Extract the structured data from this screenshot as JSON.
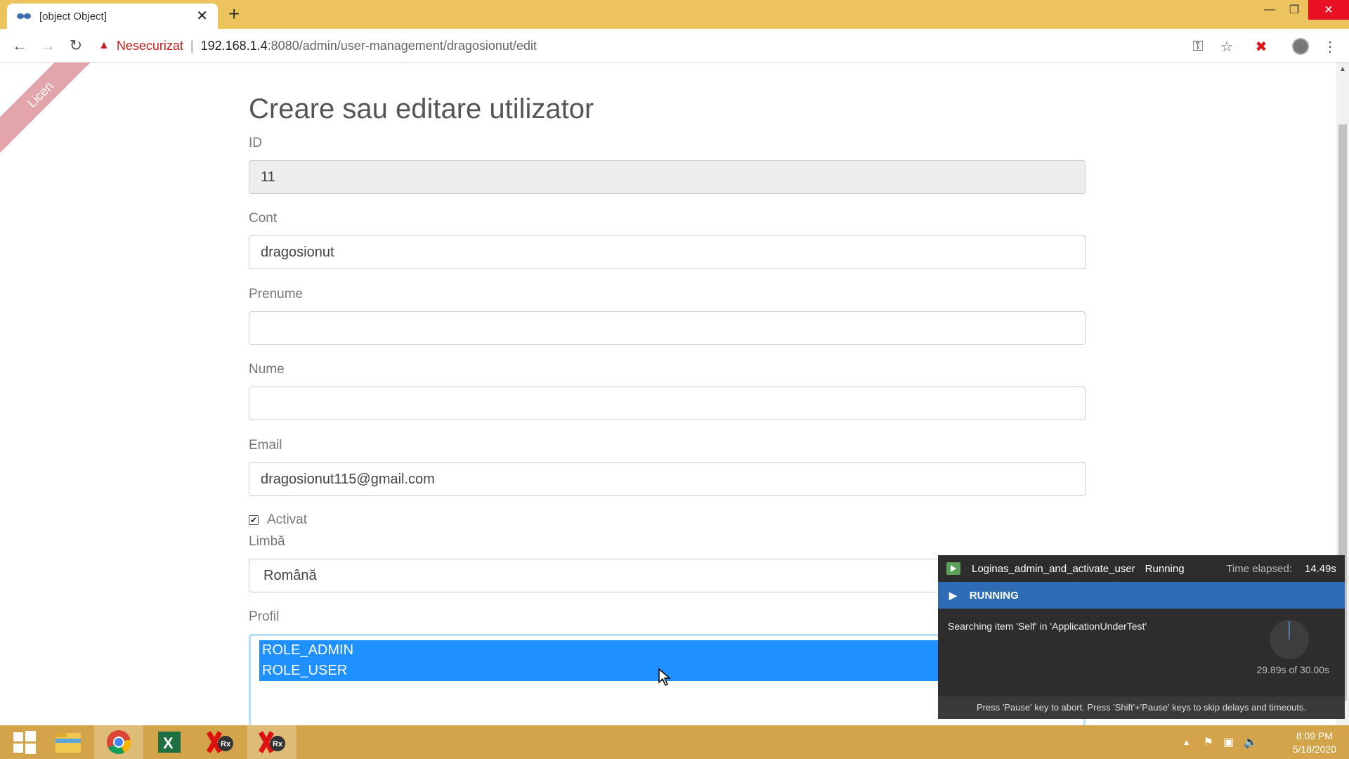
{
  "browser": {
    "tab_title": "[object Object]",
    "insecure_label": "Nesecurizat",
    "url_host": "192.168.1.4",
    "url_rest": ":8080/admin/user-management/dragosionut/edit"
  },
  "page": {
    "ribbon": "Licen",
    "title": "Creare sau editare utilizator",
    "id_label": "ID",
    "id_value": "11",
    "cont_label": "Cont",
    "cont_value": "dragosionut",
    "prenume_label": "Prenume",
    "prenume_value": "",
    "nume_label": "Nume",
    "nume_value": "",
    "email_label": "Email",
    "email_value": "dragosionut115@gmail.com",
    "activat_label": "Activat",
    "activat_checked": true,
    "limba_label": "Limbă",
    "limba_value": "Română",
    "profil_label": "Profil",
    "profil_options": [
      "ROLE_ADMIN",
      "ROLE_USER"
    ]
  },
  "runner": {
    "test_name": "Loginas_admin_and_activate_user",
    "status": "Running",
    "elapsed_label": "Time elapsed:",
    "elapsed_value": "14.49s",
    "banner": "RUNNING",
    "message": "Searching item 'Self' in 'ApplicationUnderTest'",
    "timeout": "29.89s of 30.00s",
    "footer": "Press 'Pause' key to abort. Press 'Shift'+'Pause' keys to skip delays and timeouts."
  },
  "taskbar": {
    "time": "8:09 PM",
    "date": "5/18/2020",
    "rx_label": "Rx"
  },
  "colors": {
    "titlebar": "#ecc35d",
    "taskbar": "#d3a44a",
    "selection": "#1e90ff",
    "runner_bar": "#2d6cb5",
    "insecure": "#c5221f"
  }
}
